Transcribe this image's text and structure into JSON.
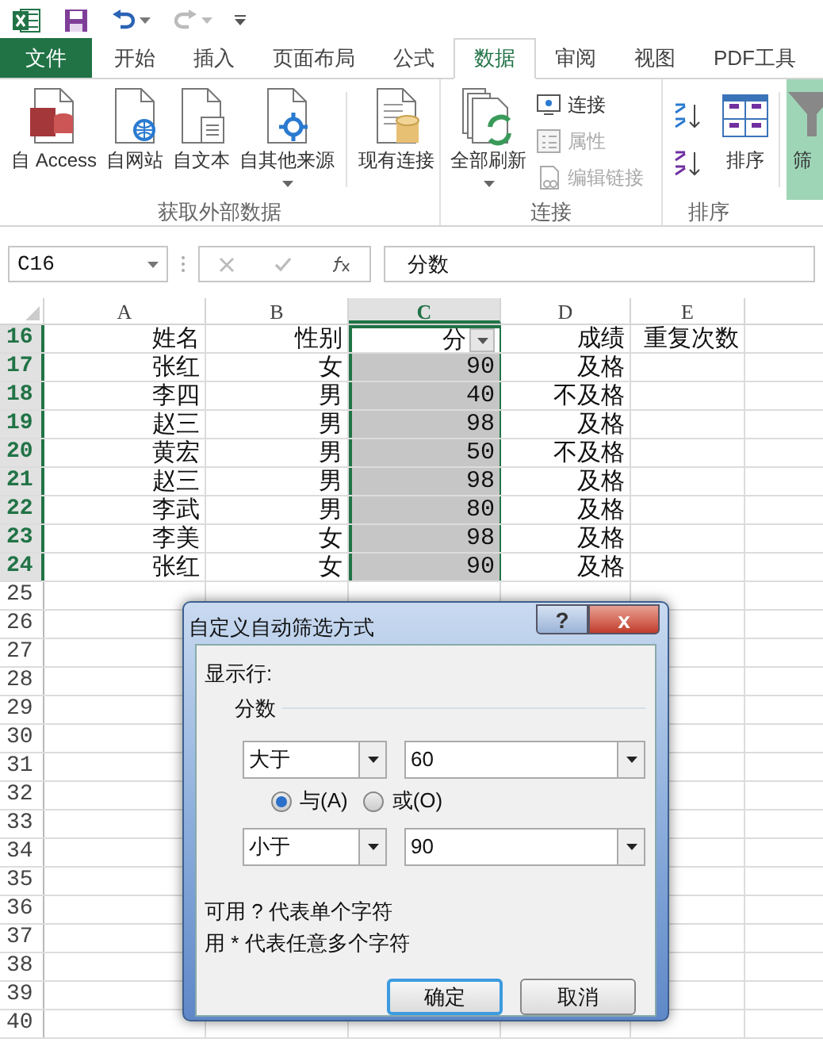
{
  "tabs": [
    {
      "label": "文件",
      "kind": "file",
      "selected": false
    },
    {
      "label": "开始",
      "kind": "tab",
      "selected": false
    },
    {
      "label": "插入",
      "kind": "tab",
      "selected": false
    },
    {
      "label": "页面布局",
      "kind": "tab",
      "selected": false
    },
    {
      "label": "公式",
      "kind": "tab",
      "selected": false
    },
    {
      "label": "数据",
      "kind": "tab",
      "selected": true
    },
    {
      "label": "审阅",
      "kind": "tab",
      "selected": false
    },
    {
      "label": "视图",
      "kind": "tab",
      "selected": false
    },
    {
      "label": "PDF工具",
      "kind": "tab",
      "selected": false
    }
  ],
  "ribbon": {
    "groups": [
      {
        "label": "获取外部数据",
        "buttons": [
          {
            "label": "自 Access",
            "kind": "large",
            "dropdown": false
          },
          {
            "label": "自网站",
            "kind": "large",
            "dropdown": false
          },
          {
            "label": "自文本",
            "kind": "large",
            "dropdown": false
          },
          {
            "label": "自其他来源",
            "kind": "large",
            "dropdown": true
          },
          {
            "label": "现有连接",
            "kind": "large",
            "dropdown": false
          }
        ]
      },
      {
        "label": "连接",
        "buttons": [
          {
            "label": "全部刷新",
            "kind": "large",
            "dropdown": true
          },
          {
            "label": "连接",
            "kind": "small",
            "disabled": false
          },
          {
            "label": "属性",
            "kind": "small",
            "disabled": true
          },
          {
            "label": "编辑链接",
            "kind": "small",
            "disabled": true
          }
        ]
      },
      {
        "label": "排序",
        "buttons": [
          {
            "kind": "icon"
          },
          {
            "kind": "icon"
          },
          {
            "label": "排序",
            "kind": "large",
            "dropdown": false
          },
          {
            "label": "筛",
            "kind": "large",
            "dropdown": false,
            "selected": true
          }
        ]
      }
    ]
  },
  "formula_bar": {
    "name_box": "C16",
    "value": "分数"
  },
  "sheet": {
    "columns": [
      {
        "label": "A",
        "selected": false
      },
      {
        "label": "B",
        "selected": false
      },
      {
        "label": "C",
        "selected": true
      },
      {
        "label": "D",
        "selected": false
      },
      {
        "label": "E",
        "selected": false
      }
    ],
    "rows": [
      {
        "number": "16",
        "kind": "header",
        "selected": true,
        "cells": [
          "姓名",
          "性别",
          "分",
          "成绩",
          "重复次数"
        ]
      },
      {
        "number": "17",
        "kind": "data",
        "selected": true,
        "cells": [
          "张红",
          "女",
          "90",
          "及格",
          ""
        ]
      },
      {
        "number": "18",
        "kind": "data",
        "selected": true,
        "cells": [
          "李四",
          "男",
          "40",
          "不及格",
          ""
        ]
      },
      {
        "number": "19",
        "kind": "data",
        "selected": true,
        "cells": [
          "赵三",
          "男",
          "98",
          "及格",
          ""
        ]
      },
      {
        "number": "20",
        "kind": "data",
        "selected": true,
        "cells": [
          "黄宏",
          "男",
          "50",
          "不及格",
          ""
        ]
      },
      {
        "number": "21",
        "kind": "data",
        "selected": true,
        "cells": [
          "赵三",
          "男",
          "98",
          "及格",
          ""
        ]
      },
      {
        "number": "22",
        "kind": "data",
        "selected": true,
        "cells": [
          "李武",
          "男",
          "80",
          "及格",
          ""
        ]
      },
      {
        "number": "23",
        "kind": "data",
        "selected": true,
        "cells": [
          "李美",
          "女",
          "98",
          "及格",
          ""
        ]
      },
      {
        "number": "24",
        "kind": "data",
        "selected": true,
        "cells": [
          "张红",
          "女",
          "90",
          "及格",
          ""
        ]
      },
      {
        "number": "25",
        "kind": "data",
        "selected": false
      },
      {
        "number": "26",
        "kind": "data",
        "selected": false
      },
      {
        "number": "27",
        "kind": "data",
        "selected": false
      },
      {
        "number": "28",
        "kind": "data",
        "selected": false
      },
      {
        "number": "29",
        "kind": "data",
        "selected": false
      },
      {
        "number": "30",
        "kind": "data",
        "selected": false
      },
      {
        "number": "31",
        "kind": "data",
        "selected": false
      },
      {
        "number": "32",
        "kind": "data",
        "selected": false
      },
      {
        "number": "33",
        "kind": "data",
        "selected": false
      },
      {
        "number": "34",
        "kind": "data",
        "selected": false
      },
      {
        "number": "35",
        "kind": "data",
        "selected": false
      },
      {
        "number": "36",
        "kind": "data",
        "selected": false
      },
      {
        "number": "37",
        "kind": "data",
        "selected": false
      },
      {
        "number": "38",
        "kind": "data",
        "selected": false
      },
      {
        "number": "39",
        "kind": "data",
        "selected": false
      },
      {
        "number": "40",
        "kind": "data",
        "selected": false
      }
    ]
  },
  "dialog": {
    "title": "自定义自动筛选方式",
    "help": "?",
    "close": "x",
    "section": "显示行:",
    "field": "分数",
    "condition_1": {
      "operator": "大于",
      "value": "60"
    },
    "logic": [
      {
        "label": "与(A)",
        "selected": true
      },
      {
        "label": "或(O)",
        "selected": false
      }
    ],
    "condition_2": {
      "operator": "小于",
      "value": "90"
    },
    "hints": [
      "可用 ? 代表单个字符",
      "用 * 代表任意多个字符"
    ],
    "buttons": [
      {
        "label": "确定",
        "default": true
      },
      {
        "label": "取消",
        "default": false
      }
    ]
  }
}
